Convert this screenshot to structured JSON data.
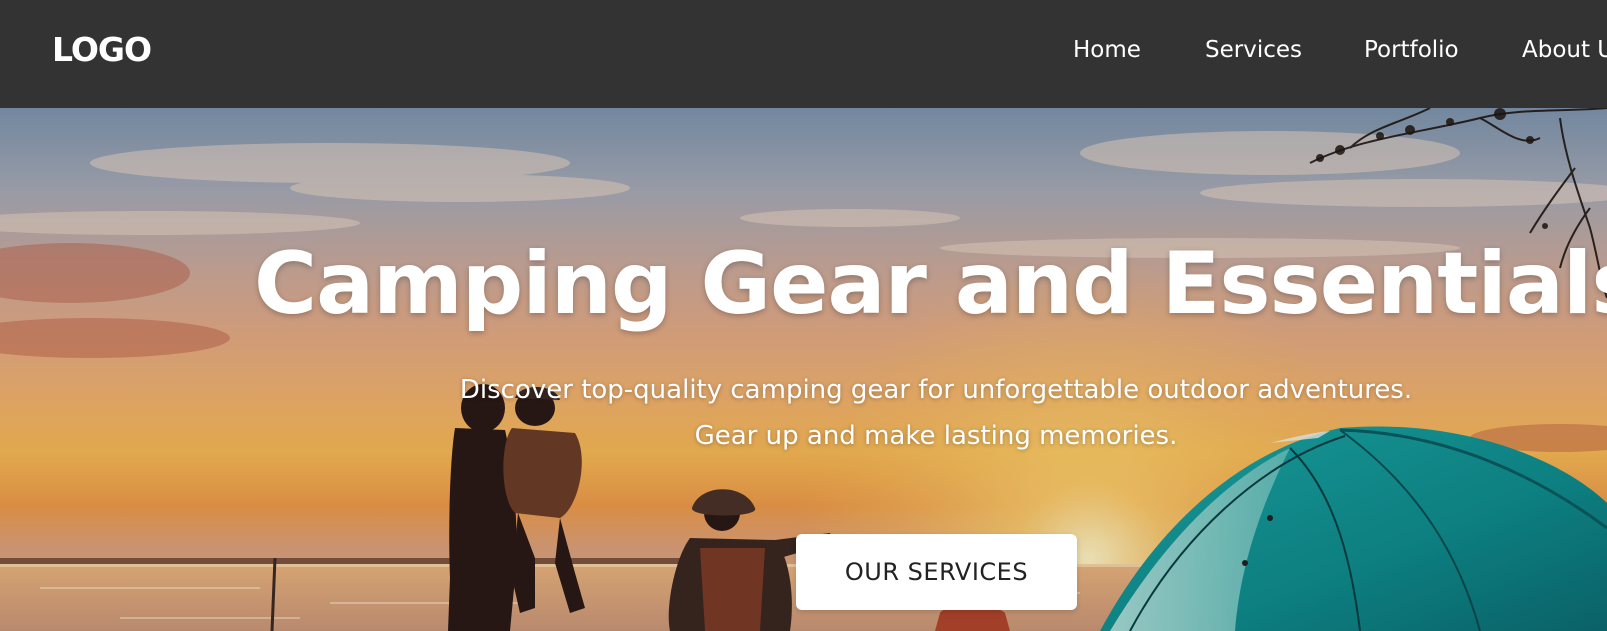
{
  "navbar": {
    "logo": "LOGO",
    "links": [
      "Home",
      "Services",
      "Portfolio",
      "About U"
    ]
  },
  "hero": {
    "title": "Camping Gear and Essentials",
    "subtitle_line1": "Discover top-quality camping gear for unforgettable outdoor adventures.",
    "subtitle_line2": "Gear up and make lasting memories.",
    "cta_label": "OUR SERVICES"
  },
  "colors": {
    "navbar_bg": "#333333",
    "text": "#ffffff",
    "button_bg": "#ffffff",
    "button_text": "#222222",
    "tent_teal": "#0f8a8c"
  },
  "icons": [
    "sunset-camping-photo"
  ]
}
